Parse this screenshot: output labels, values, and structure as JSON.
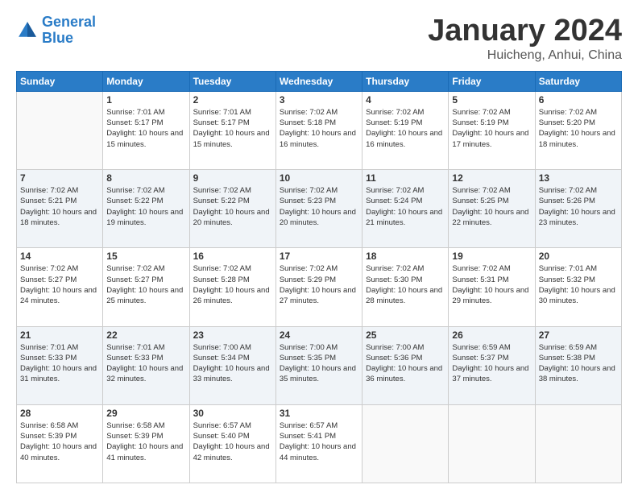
{
  "logo": {
    "line1": "General",
    "line2": "Blue"
  },
  "title": "January 2024",
  "subtitle": "Huicheng, Anhui, China",
  "days_of_week": [
    "Sunday",
    "Monday",
    "Tuesday",
    "Wednesday",
    "Thursday",
    "Friday",
    "Saturday"
  ],
  "weeks": [
    [
      {
        "day": "",
        "sunrise": "",
        "sunset": "",
        "daylight": ""
      },
      {
        "day": "1",
        "sunrise": "Sunrise: 7:01 AM",
        "sunset": "Sunset: 5:17 PM",
        "daylight": "Daylight: 10 hours and 15 minutes."
      },
      {
        "day": "2",
        "sunrise": "Sunrise: 7:01 AM",
        "sunset": "Sunset: 5:17 PM",
        "daylight": "Daylight: 10 hours and 15 minutes."
      },
      {
        "day": "3",
        "sunrise": "Sunrise: 7:02 AM",
        "sunset": "Sunset: 5:18 PM",
        "daylight": "Daylight: 10 hours and 16 minutes."
      },
      {
        "day": "4",
        "sunrise": "Sunrise: 7:02 AM",
        "sunset": "Sunset: 5:19 PM",
        "daylight": "Daylight: 10 hours and 16 minutes."
      },
      {
        "day": "5",
        "sunrise": "Sunrise: 7:02 AM",
        "sunset": "Sunset: 5:19 PM",
        "daylight": "Daylight: 10 hours and 17 minutes."
      },
      {
        "day": "6",
        "sunrise": "Sunrise: 7:02 AM",
        "sunset": "Sunset: 5:20 PM",
        "daylight": "Daylight: 10 hours and 18 minutes."
      }
    ],
    [
      {
        "day": "7",
        "sunrise": "Sunrise: 7:02 AM",
        "sunset": "Sunset: 5:21 PM",
        "daylight": "Daylight: 10 hours and 18 minutes."
      },
      {
        "day": "8",
        "sunrise": "Sunrise: 7:02 AM",
        "sunset": "Sunset: 5:22 PM",
        "daylight": "Daylight: 10 hours and 19 minutes."
      },
      {
        "day": "9",
        "sunrise": "Sunrise: 7:02 AM",
        "sunset": "Sunset: 5:22 PM",
        "daylight": "Daylight: 10 hours and 20 minutes."
      },
      {
        "day": "10",
        "sunrise": "Sunrise: 7:02 AM",
        "sunset": "Sunset: 5:23 PM",
        "daylight": "Daylight: 10 hours and 20 minutes."
      },
      {
        "day": "11",
        "sunrise": "Sunrise: 7:02 AM",
        "sunset": "Sunset: 5:24 PM",
        "daylight": "Daylight: 10 hours and 21 minutes."
      },
      {
        "day": "12",
        "sunrise": "Sunrise: 7:02 AM",
        "sunset": "Sunset: 5:25 PM",
        "daylight": "Daylight: 10 hours and 22 minutes."
      },
      {
        "day": "13",
        "sunrise": "Sunrise: 7:02 AM",
        "sunset": "Sunset: 5:26 PM",
        "daylight": "Daylight: 10 hours and 23 minutes."
      }
    ],
    [
      {
        "day": "14",
        "sunrise": "Sunrise: 7:02 AM",
        "sunset": "Sunset: 5:27 PM",
        "daylight": "Daylight: 10 hours and 24 minutes."
      },
      {
        "day": "15",
        "sunrise": "Sunrise: 7:02 AM",
        "sunset": "Sunset: 5:27 PM",
        "daylight": "Daylight: 10 hours and 25 minutes."
      },
      {
        "day": "16",
        "sunrise": "Sunrise: 7:02 AM",
        "sunset": "Sunset: 5:28 PM",
        "daylight": "Daylight: 10 hours and 26 minutes."
      },
      {
        "day": "17",
        "sunrise": "Sunrise: 7:02 AM",
        "sunset": "Sunset: 5:29 PM",
        "daylight": "Daylight: 10 hours and 27 minutes."
      },
      {
        "day": "18",
        "sunrise": "Sunrise: 7:02 AM",
        "sunset": "Sunset: 5:30 PM",
        "daylight": "Daylight: 10 hours and 28 minutes."
      },
      {
        "day": "19",
        "sunrise": "Sunrise: 7:02 AM",
        "sunset": "Sunset: 5:31 PM",
        "daylight": "Daylight: 10 hours and 29 minutes."
      },
      {
        "day": "20",
        "sunrise": "Sunrise: 7:01 AM",
        "sunset": "Sunset: 5:32 PM",
        "daylight": "Daylight: 10 hours and 30 minutes."
      }
    ],
    [
      {
        "day": "21",
        "sunrise": "Sunrise: 7:01 AM",
        "sunset": "Sunset: 5:33 PM",
        "daylight": "Daylight: 10 hours and 31 minutes."
      },
      {
        "day": "22",
        "sunrise": "Sunrise: 7:01 AM",
        "sunset": "Sunset: 5:33 PM",
        "daylight": "Daylight: 10 hours and 32 minutes."
      },
      {
        "day": "23",
        "sunrise": "Sunrise: 7:00 AM",
        "sunset": "Sunset: 5:34 PM",
        "daylight": "Daylight: 10 hours and 33 minutes."
      },
      {
        "day": "24",
        "sunrise": "Sunrise: 7:00 AM",
        "sunset": "Sunset: 5:35 PM",
        "daylight": "Daylight: 10 hours and 35 minutes."
      },
      {
        "day": "25",
        "sunrise": "Sunrise: 7:00 AM",
        "sunset": "Sunset: 5:36 PM",
        "daylight": "Daylight: 10 hours and 36 minutes."
      },
      {
        "day": "26",
        "sunrise": "Sunrise: 6:59 AM",
        "sunset": "Sunset: 5:37 PM",
        "daylight": "Daylight: 10 hours and 37 minutes."
      },
      {
        "day": "27",
        "sunrise": "Sunrise: 6:59 AM",
        "sunset": "Sunset: 5:38 PM",
        "daylight": "Daylight: 10 hours and 38 minutes."
      }
    ],
    [
      {
        "day": "28",
        "sunrise": "Sunrise: 6:58 AM",
        "sunset": "Sunset: 5:39 PM",
        "daylight": "Daylight: 10 hours and 40 minutes."
      },
      {
        "day": "29",
        "sunrise": "Sunrise: 6:58 AM",
        "sunset": "Sunset: 5:39 PM",
        "daylight": "Daylight: 10 hours and 41 minutes."
      },
      {
        "day": "30",
        "sunrise": "Sunrise: 6:57 AM",
        "sunset": "Sunset: 5:40 PM",
        "daylight": "Daylight: 10 hours and 42 minutes."
      },
      {
        "day": "31",
        "sunrise": "Sunrise: 6:57 AM",
        "sunset": "Sunset: 5:41 PM",
        "daylight": "Daylight: 10 hours and 44 minutes."
      },
      {
        "day": "",
        "sunrise": "",
        "sunset": "",
        "daylight": ""
      },
      {
        "day": "",
        "sunrise": "",
        "sunset": "",
        "daylight": ""
      },
      {
        "day": "",
        "sunrise": "",
        "sunset": "",
        "daylight": ""
      }
    ]
  ]
}
